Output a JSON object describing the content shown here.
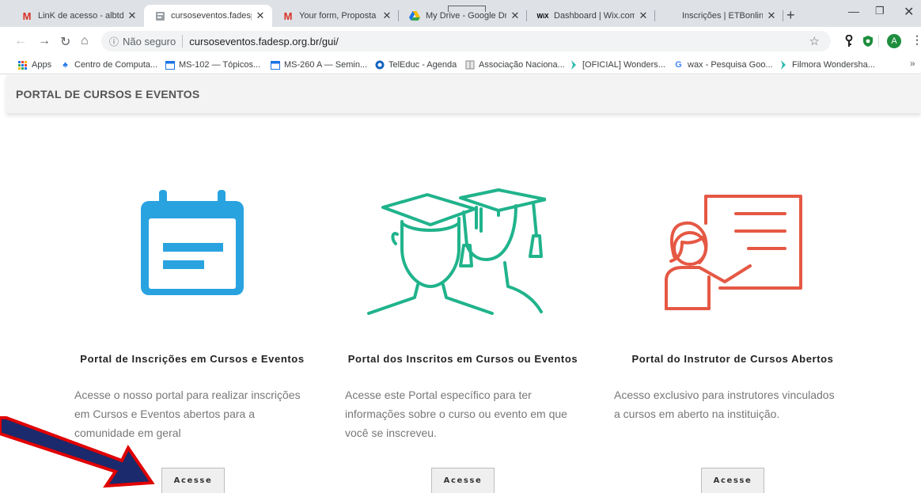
{
  "browser": {
    "tabs": [
      {
        "title": "LinK de acesso - albtdia",
        "favicon": "gmail-icon",
        "color": "#d93025"
      },
      {
        "title": "cursoseventos.fadesp.o",
        "favicon": "page-icon",
        "color": "#5f6368"
      },
      {
        "title": "Your form, Proposta ETI",
        "favicon": "gmail-icon",
        "color": "#d93025"
      },
      {
        "title": "My Drive - Google Drive",
        "favicon": "drive-icon",
        "color": "#1a73e8"
      },
      {
        "title": "Dashboard | Wix.com",
        "favicon": "wix-icon",
        "color": "#000000"
      },
      {
        "title": "Inscrições | ETBonline",
        "favicon": "blank-icon",
        "color": "#ffffff"
      }
    ],
    "address": {
      "security_label": "Não seguro",
      "url": "cursoseventos.fadesp.org.br/gui/"
    },
    "avatar_letter": "A",
    "bookmarks": [
      {
        "label": "Apps",
        "icon": "apps-icon"
      },
      {
        "label": "Centro de Computa...",
        "icon": "ccmp-icon"
      },
      {
        "label": "MS-102 — Tópicos...",
        "icon": "calendar-icon"
      },
      {
        "label": "MS-260 A — Semin...",
        "icon": "calendar-icon"
      },
      {
        "label": "TelEduc - Agenda",
        "icon": "teleduc-icon"
      },
      {
        "label": "Associação Naciona...",
        "icon": "book-icon"
      },
      {
        "label": "[OFICIAL] Wonders...",
        "icon": "wondershare-icon"
      },
      {
        "label": "wax - Pesquisa Goo...",
        "icon": "google-icon"
      },
      {
        "label": "Filmora Wondersha...",
        "icon": "wondershare-icon"
      }
    ]
  },
  "page": {
    "brand": "PORTAL DE CURSOS E EVENTOS",
    "cards": [
      {
        "title": "Portal de Inscrições em Cursos e Eventos",
        "desc_lines": [
          "Acesse o nosso portal para realizar inscrições",
          "em Cursos e Eventos abertos para a",
          "comunidade em geral"
        ],
        "button": "Acesse",
        "icon": "calendar-icon",
        "color": "#29a3e0"
      },
      {
        "title": "Portal dos Inscritos em Cursos ou Eventos",
        "desc_lines": [
          "Acesse este Portal específico para ter",
          "informações sobre o curso ou evento em que",
          "você se inscreveu."
        ],
        "button": "Acesse",
        "icon": "graduates-icon",
        "color": "#20b38c"
      },
      {
        "title": "Portal do Instrutor de Cursos Abertos",
        "desc_lines": [
          "Acesso exclusivo para instrutores vinculados",
          "a cursos em aberto na instituição."
        ],
        "button": "Acesse",
        "icon": "instructor-icon",
        "color": "#e55844"
      }
    ]
  },
  "annotation": {
    "arrow_color": "#1a2a6c",
    "arrow_outline": "#e00000"
  }
}
